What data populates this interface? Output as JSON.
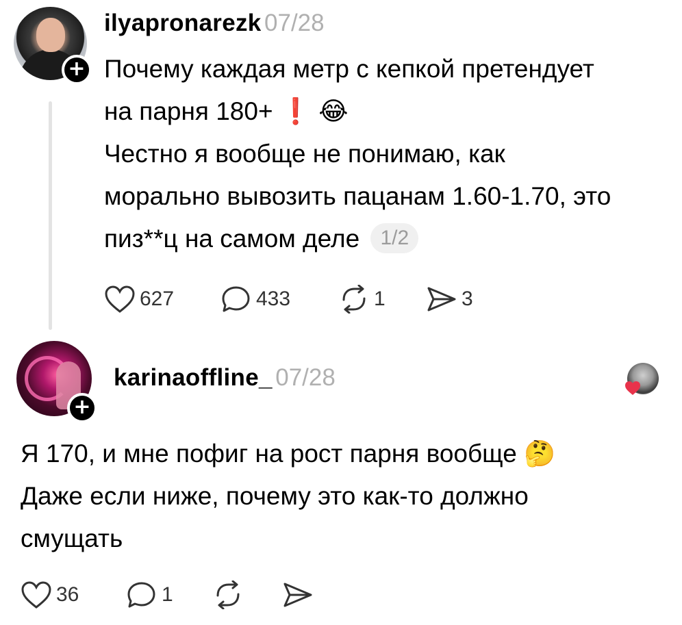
{
  "post1": {
    "username": "ilyapronarezk",
    "date": "07/28",
    "lines": [
      "Почему каждая метр с кепкой претендует",
      "на парня 180+ ",
      "Честно я вообще не понимаю, как",
      "морально вывозить пацанам 1.60-1.70, это",
      "пиз**ц на самом деле"
    ],
    "emoji_exclaim": "❗",
    "emoji_laugh": "😂",
    "pager": "1/2",
    "likes": "627",
    "replies": "433",
    "reposts": "1",
    "shares": "3"
  },
  "post2": {
    "username": "karinaoffline_",
    "date": "07/28",
    "lines": [
      "Я 170, и мне пофиг на рост парня вообще ",
      "Даже если ниже, почему это как-то должно",
      "смущать"
    ],
    "emoji_think": "🤔",
    "likes": "36",
    "replies": "1"
  },
  "icons": {
    "plus": "+",
    "heart_color": "#e8334b"
  }
}
